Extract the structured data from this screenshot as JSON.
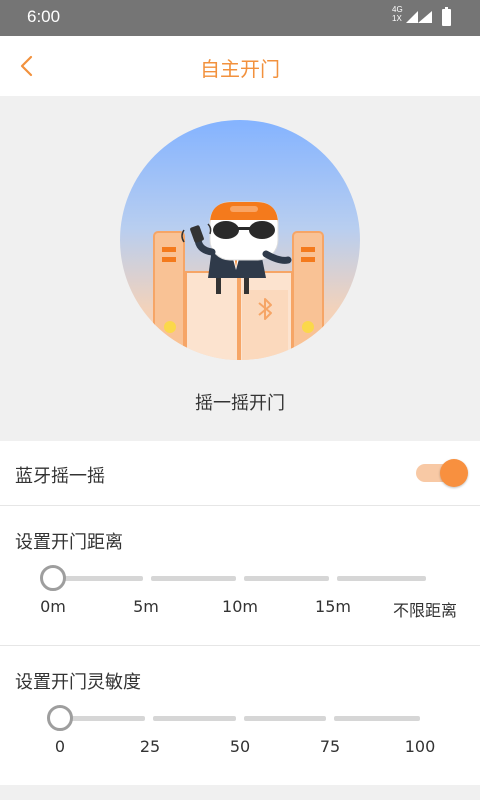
{
  "status_bar": {
    "time": "6:00",
    "network_top": "4G",
    "network_bottom": "1X"
  },
  "header": {
    "title": "自主开门",
    "back_icon": "chevron-left-icon"
  },
  "hero": {
    "caption": "摇一摇开门",
    "illustration": "shake-door-mascot-illustration"
  },
  "bluetooth_shake": {
    "label": "蓝牙摇一摇",
    "enabled": true,
    "accent": "#f8903f"
  },
  "distance": {
    "title": "设置开门距离",
    "ticks": [
      "0m",
      "5m",
      "10m",
      "15m",
      "不限距离"
    ],
    "selected": "0m"
  },
  "sensitivity": {
    "title": "设置开门灵敏度",
    "ticks": [
      "0",
      "25",
      "50",
      "75",
      "100"
    ],
    "selected": "0"
  },
  "colors": {
    "accent": "#f2913d",
    "background": "#f0f0f0"
  }
}
